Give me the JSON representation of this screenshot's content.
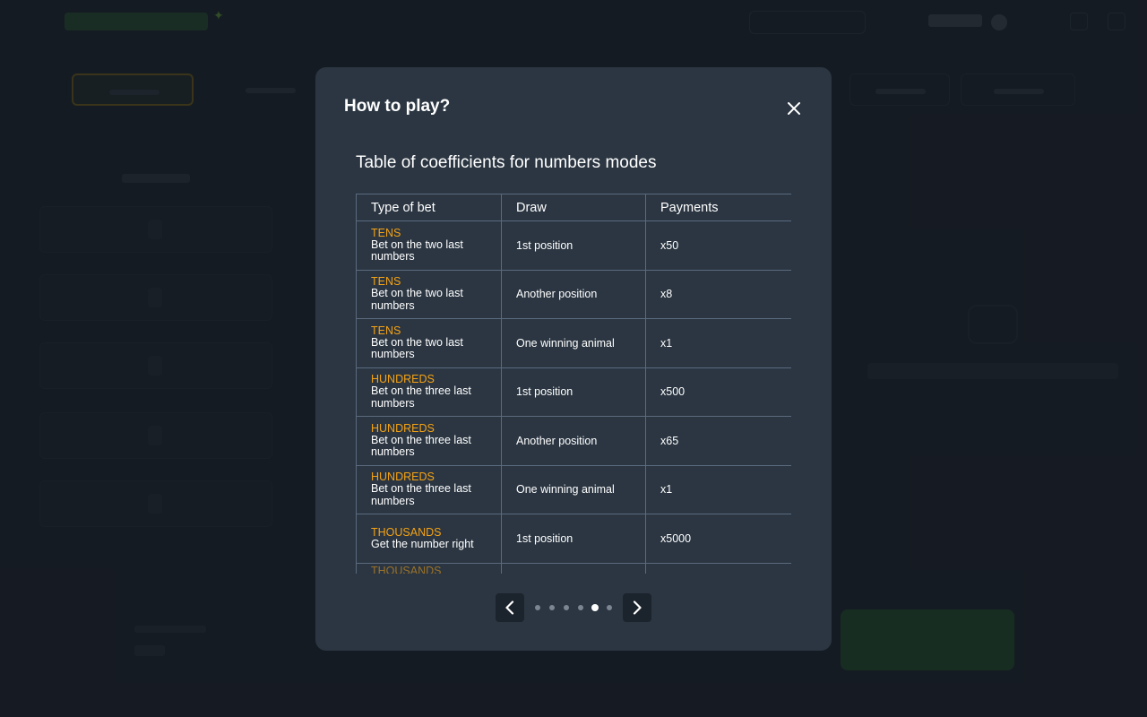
{
  "modal": {
    "title": "How to play?",
    "section_title": "Table of coefficients for numbers modes",
    "table": {
      "headers": [
        "Type of bet",
        "Draw",
        "Payments"
      ],
      "rows": [
        {
          "type": "TENS",
          "desc": "Bet on the two last numbers",
          "draw": "1st position",
          "payment": "x50"
        },
        {
          "type": "TENS",
          "desc": "Bet on the two last numbers",
          "draw": "Another position",
          "payment": "x8"
        },
        {
          "type": "TENS",
          "desc": "Bet on the two last numbers",
          "draw": "One winning animal",
          "payment": "x1"
        },
        {
          "type": "HUNDREDS",
          "desc": "Bet on the three last numbers",
          "draw": "1st position",
          "payment": "x500"
        },
        {
          "type": "HUNDREDS",
          "desc": "Bet on the three last numbers",
          "draw": "Another position",
          "payment": "x65"
        },
        {
          "type": "HUNDREDS",
          "desc": "Bet on the three last numbers",
          "draw": "One winning animal",
          "payment": "x1"
        },
        {
          "type": "THOUSANDS",
          "desc": "Get the number right",
          "draw": "1st position",
          "payment": "x5000"
        },
        {
          "type": "THOUSANDS",
          "desc": "",
          "draw": "",
          "payment": ""
        }
      ]
    },
    "pager": {
      "page_count": 6,
      "active_index": 4
    },
    "icons": {
      "close": "close-icon",
      "prev": "chevron-left-icon",
      "next": "chevron-right-icon"
    }
  },
  "colors": {
    "background": "#1b222b",
    "modal": "#2b3642",
    "accent": "#f5a214",
    "table_border": "#5b6a7e",
    "nav_button": "#1b232c"
  }
}
